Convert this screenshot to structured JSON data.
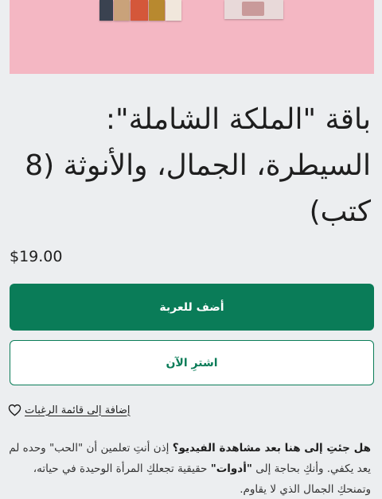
{
  "product": {
    "title": "باقة \"الملكة الشاملة\": السيطرة، الجمال، والأنوثة (8 كتب)",
    "price": "$19.00"
  },
  "actions": {
    "add_to_cart": "أضف للعربة",
    "buy_now": "اشترِ الآن",
    "wishlist": "إضافة إلى قائمة الرغبات"
  },
  "description": {
    "intro_bold": "هل جئتِ إلى هنا بعد مشاهدة الفيديو؟",
    "part1": " إذن أنتِ تعلمين أن \"الحب\" وحده لم يعد يكفي. وأنكِ بحاجة إلى ",
    "tools_bold": "\"أدوات\"",
    "part2": " حقيقية تجعلكِ المرأة الوحيدة في حياته، وتمنحكِ الجمال الذي لا يقاوم."
  },
  "colors": {
    "primary": "#0a7c58",
    "background": "#eceef0",
    "hero": "#f4b7c3"
  },
  "icons": {
    "wishlist": "heart-outline-icon"
  }
}
